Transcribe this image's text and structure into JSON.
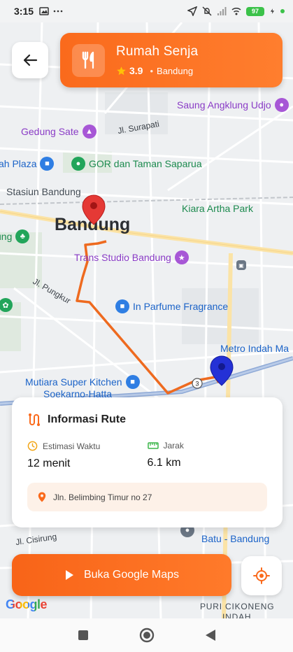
{
  "status_bar": {
    "time": "3:15",
    "battery": "97"
  },
  "map": {
    "city_label": "Bandung",
    "pois": [
      {
        "name": "Saung Angklung Udjo",
        "style": "purple",
        "icon": "palette-icon"
      },
      {
        "name": "Gedung Sate",
        "style": "purple",
        "icon": "landmark-icon"
      },
      {
        "name": "ah Plaza",
        "style": "blue",
        "icon": "shopping-bag-icon"
      },
      {
        "name": "GOR dan Taman Saparua",
        "style": "green",
        "icon": "park-icon"
      },
      {
        "name": "Stasiun Bandung",
        "style": "dark",
        "icon": "train-icon"
      },
      {
        "name": "Kiara Artha Park",
        "style": "green",
        "icon": "park-icon"
      },
      {
        "name": "Trans Studio Bandung",
        "style": "purple",
        "icon": "amusement-icon"
      },
      {
        "name": "In Parfume Fragrance",
        "style": "blue",
        "icon": "shopping-bag-icon"
      },
      {
        "name": "Metro Indah Ma",
        "style": "blue",
        "icon": "shopping-bag-icon"
      },
      {
        "name": "Mutiara Super Kitchen",
        "style": "blue",
        "icon": "shopping-bag-icon"
      },
      {
        "name": "Soekarno-Hatta",
        "style": "blue",
        "icon": "none"
      },
      {
        "name": "Batu - Bandung",
        "style": "blue",
        "icon": "none"
      },
      {
        "name": "PURI CIKONENG",
        "style": "dark",
        "icon": "none"
      },
      {
        "name": "INDAH",
        "style": "dark",
        "icon": "none"
      }
    ],
    "streets": [
      "Jl. Surapati",
      "Jl. Pungkur",
      "Jl. Cisirung"
    ],
    "google_logo": "Google"
  },
  "header": {
    "restaurant_name": "Rumah Senja",
    "rating": "3.9",
    "separator": "•",
    "city": "Bandung",
    "colors": {
      "accent": "#fa6a1c",
      "star": "#ffc107"
    }
  },
  "route_info": {
    "title": "Informasi Rute",
    "duration_label": "Estimasi Waktu",
    "duration_value": "12 menit",
    "distance_label": "Jarak",
    "distance_value": "6.1 km",
    "address": "Jln. Belimbing Timur no 27"
  },
  "actions": {
    "open_maps_label": "Buka Google Maps"
  }
}
